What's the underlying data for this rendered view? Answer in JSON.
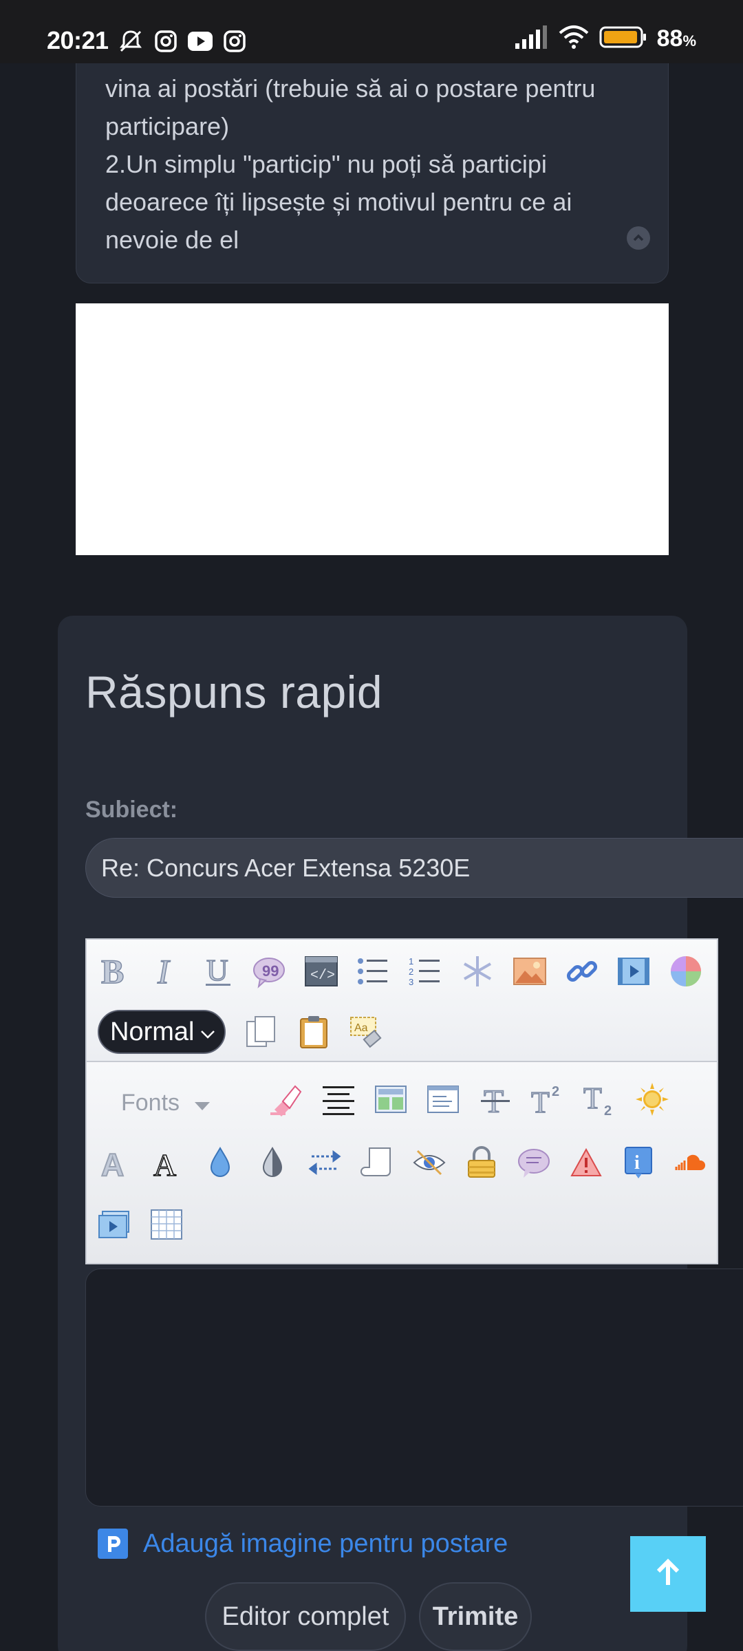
{
  "status_bar": {
    "time": "20:21",
    "battery_percent": "88",
    "battery_unit": "%",
    "icons": [
      "mute-bell-icon",
      "instagram-icon",
      "youtube-icon",
      "instagram-icon",
      "signal-icon",
      "wifi-icon",
      "battery-icon"
    ]
  },
  "post": {
    "lines": [
      "vina ai postări (trebuie să ai o postare pentru",
      "participare)",
      "2.Un simplu \"particip\" nu poți să participi",
      "deoarece îți lipsește și motivul pentru ce ai",
      "nevoie de el"
    ]
  },
  "reply": {
    "title": "Răspuns rapid",
    "subject_label": "Subiect:",
    "subject_value": "Re: Concurs Acer Extensa 5230E",
    "format_select": "Normal",
    "fonts_label": "Fonts",
    "add_image_label": "Adaugă imagine pentru postare",
    "editor_button": "Editor complet",
    "send_button": "Trimite"
  },
  "colors": {
    "background": "#1a1d24",
    "panel": "#262b36",
    "link": "#3b87e8",
    "scroll_top": "#58d0f6"
  }
}
